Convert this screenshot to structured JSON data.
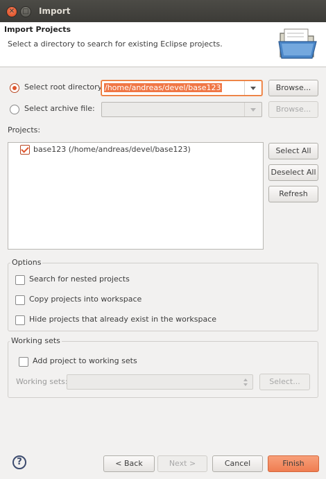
{
  "window": {
    "title": "Import"
  },
  "banner": {
    "heading": "Import Projects",
    "description": "Select a directory to search for existing Eclipse projects."
  },
  "source": {
    "root_label": "Select root directory:",
    "root_value": "/home/andreas/devel/base123",
    "root_selected": true,
    "archive_label": "Select archive file:",
    "archive_value": "",
    "archive_selected": false,
    "browse_label": "Browse..."
  },
  "projects": {
    "label": "Projects:",
    "items": [
      {
        "label": "base123 (/home/andreas/devel/base123)",
        "checked": true
      }
    ],
    "select_all": "Select All",
    "deselect_all": "Deselect All",
    "refresh": "Refresh"
  },
  "options": {
    "title": "Options",
    "items": [
      {
        "label": "Search for nested projects",
        "checked": false
      },
      {
        "label": "Copy projects into workspace",
        "checked": false
      },
      {
        "label": "Hide projects that already exist in the workspace",
        "checked": false
      }
    ]
  },
  "working_sets": {
    "title": "Working sets",
    "add_label": "Add project to working sets",
    "add_checked": false,
    "field_label": "Working sets:",
    "field_value": "",
    "select_button": "Select..."
  },
  "footer": {
    "back": "< Back",
    "next": "Next >",
    "cancel": "Cancel",
    "finish": "Finish",
    "help_glyph": "?"
  },
  "colors": {
    "accent": "#e0552d",
    "finish_button": "#ef7d51",
    "titlebar": "#3c3b37"
  }
}
